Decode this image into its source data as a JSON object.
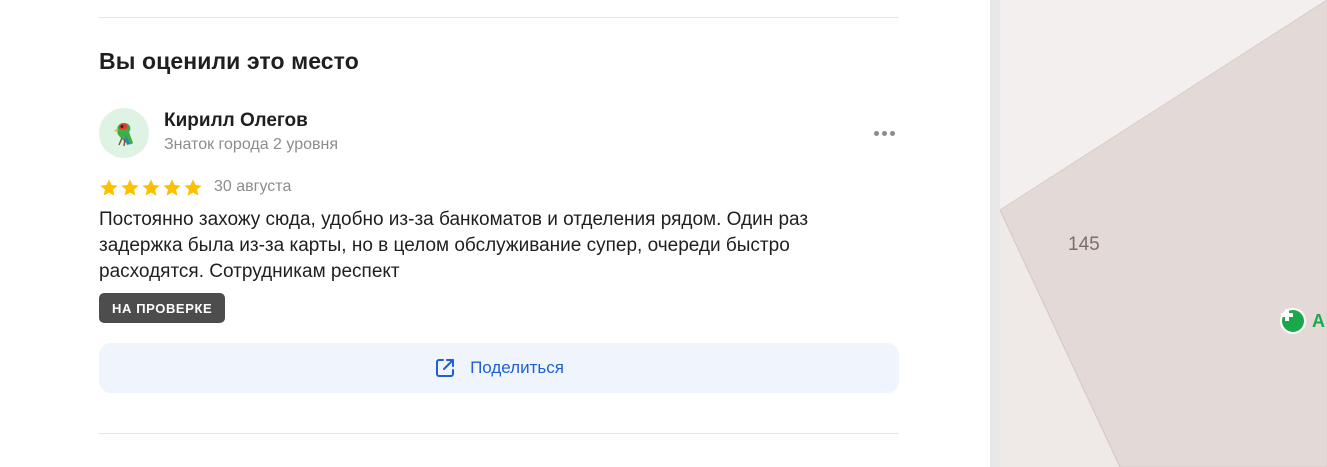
{
  "section": {
    "title": "Вы оценили это место"
  },
  "review": {
    "author_name": "Кирилл Олегов",
    "author_level": "Знаток города 2 уровня",
    "rating": 5,
    "rating_max": 5,
    "date": "30 августа",
    "text": "Постоянно захожу сюда, удобно из-за банкоматов и отделения рядом. Один раз задержка была из-за карты, но в целом обслуживание супер, очереди быстро расходятся. Сотрудникам респект",
    "status": "НА ПРОВЕРКЕ",
    "avatar_icon": "parrot-icon"
  },
  "actions": {
    "share_label": "Поделиться",
    "share_icon": "external-link-icon",
    "more_icon": "more-dots-icon"
  },
  "map": {
    "house_number": "145",
    "poi_label": "А",
    "poi_icon": "pharmacy-cross-icon"
  },
  "colors": {
    "star": "#fcc000",
    "link": "#1f5fd6",
    "badge_bg": "#4d4d4d",
    "share_bg": "#f0f4fd",
    "poi": "#19a94b"
  }
}
